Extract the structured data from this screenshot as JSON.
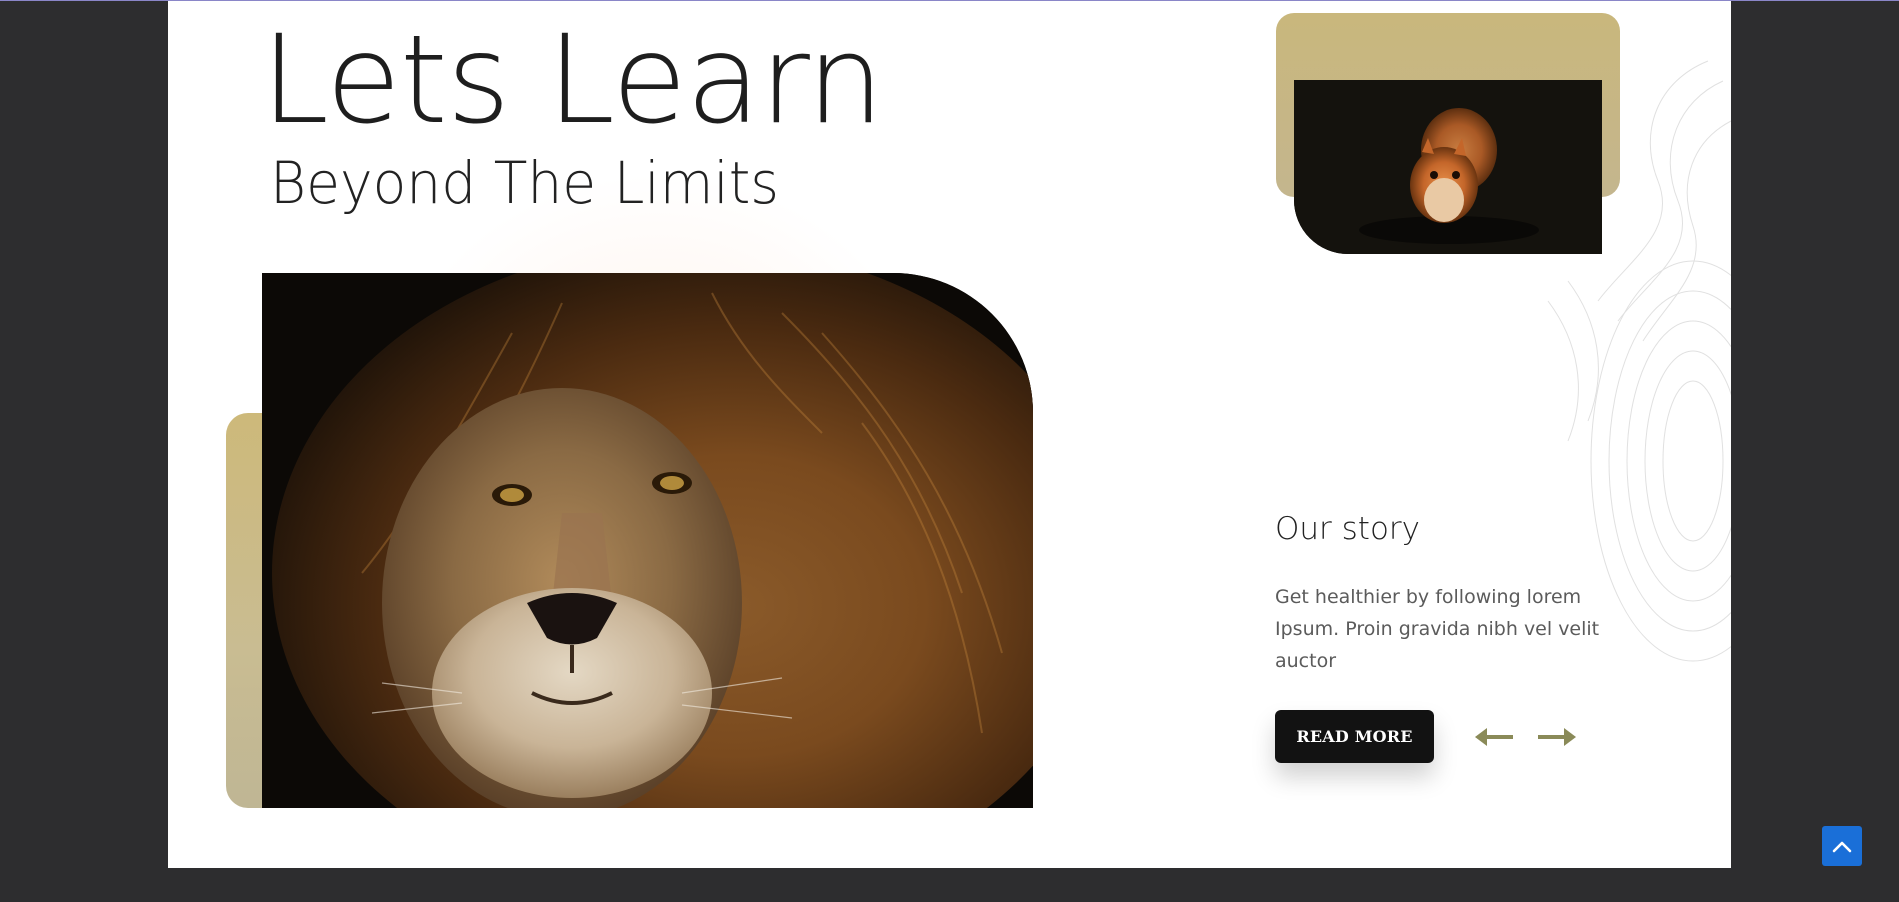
{
  "hero": {
    "title": "Lets Learn",
    "subtitle": "Beyond The Limits",
    "main_image": {
      "icon": "lion-photo"
    },
    "secondary_image": {
      "icon": "squirrel-photo"
    }
  },
  "story": {
    "heading": "Our story",
    "body": "Get healthier by following lorem Ipsum. Proin gravida nibh vel velit auctor",
    "button_label": "READ MORE"
  },
  "slider": {
    "prev_icon": "arrow-left-icon",
    "next_icon": "arrow-right-icon"
  },
  "scroll_top": {
    "icon": "chevron-up-icon"
  },
  "colors": {
    "background": "#2d2d2f",
    "panel": "#ffffff",
    "gold_accent": "#cdb97a",
    "arrow": "#8a8a58",
    "button": "#121212",
    "scroll_top": "#1a6fd8"
  }
}
